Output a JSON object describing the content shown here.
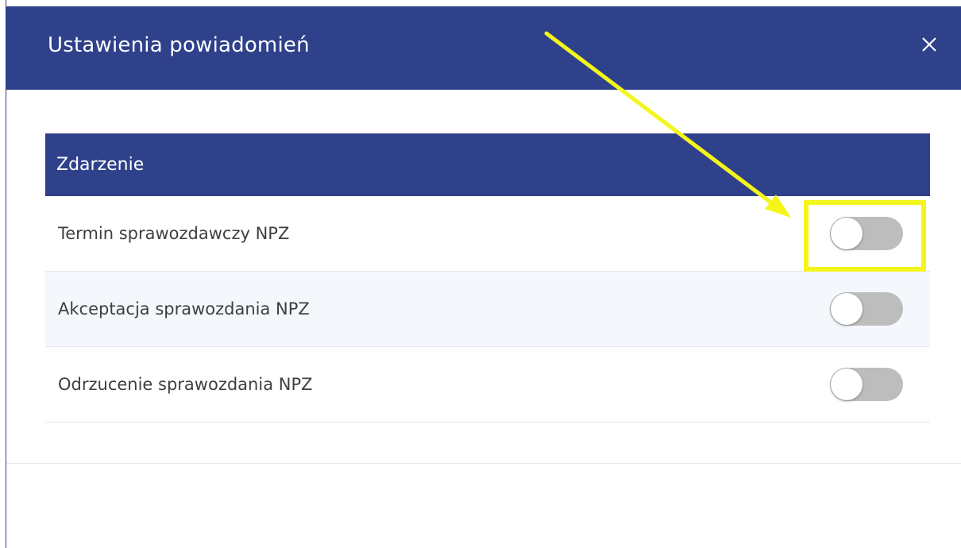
{
  "dialog": {
    "title": "Ustawienia powiadomień",
    "close_label": "X"
  },
  "table": {
    "header_label": "Zdarzenie",
    "rows": [
      {
        "label": "Termin sprawozdawczy NPZ",
        "enabled": false
      },
      {
        "label": "Akceptacja sprawozdania NPZ",
        "enabled": false
      },
      {
        "label": "Odrzucenie sprawozdania NPZ",
        "enabled": false
      }
    ]
  },
  "annotation": {
    "arrow_color": "#f4f51a",
    "target": "toggle for Termin sprawozdawczy NPZ"
  },
  "colors": {
    "header_bg": "#2f418a",
    "toggle_off": "#bdbdbd",
    "row_alt_bg": "#f4f7fc"
  }
}
